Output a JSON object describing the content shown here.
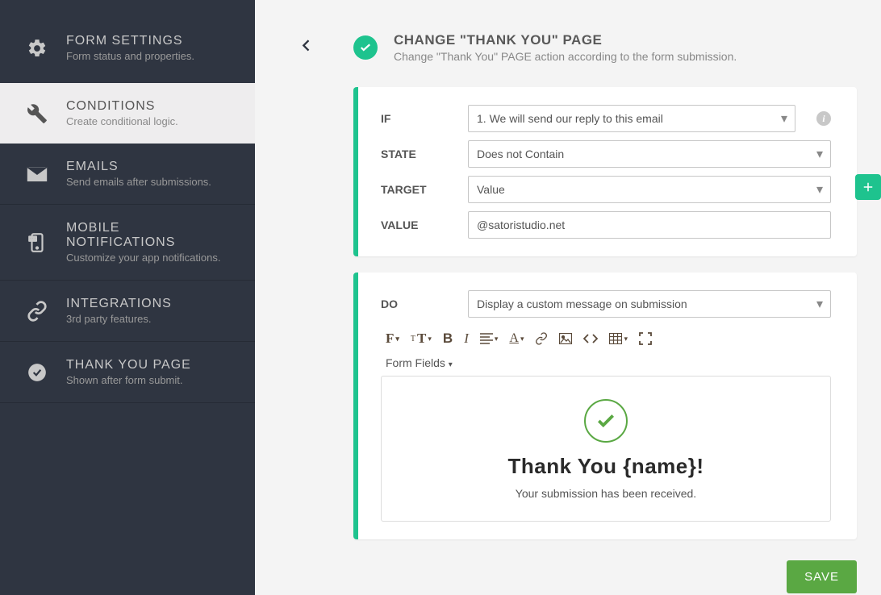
{
  "sidebar": {
    "items": [
      {
        "title": "FORM SETTINGS",
        "subtitle": "Form status and properties."
      },
      {
        "title": "CONDITIONS",
        "subtitle": "Create conditional logic."
      },
      {
        "title": "EMAILS",
        "subtitle": "Send emails after submissions."
      },
      {
        "title": "MOBILE NOTIFICATIONS",
        "subtitle": "Customize your app notifications."
      },
      {
        "title": "INTEGRATIONS",
        "subtitle": "3rd party features."
      },
      {
        "title": "THANK YOU PAGE",
        "subtitle": "Shown after form submit."
      }
    ]
  },
  "header": {
    "title": "CHANGE \"THANK YOU\" PAGE",
    "subtitle": "Change \"Thank You\" PAGE action according to the form submission."
  },
  "condition_panel": {
    "labels": {
      "if": "IF",
      "state": "STATE",
      "target": "TARGET",
      "value_lbl": "VALUE"
    },
    "if_select": "1. We will send our reply to this email",
    "state_select": "Does not Contain",
    "target_select": "Value",
    "value_input": "@satoristudio.net"
  },
  "do_panel": {
    "label": "DO",
    "do_select": "Display a custom message on submission",
    "form_fields_label": "Form Fields",
    "message_title": "Thank You {name}!",
    "message_sub": "Your submission has been received."
  },
  "buttons": {
    "save": "SAVE"
  }
}
